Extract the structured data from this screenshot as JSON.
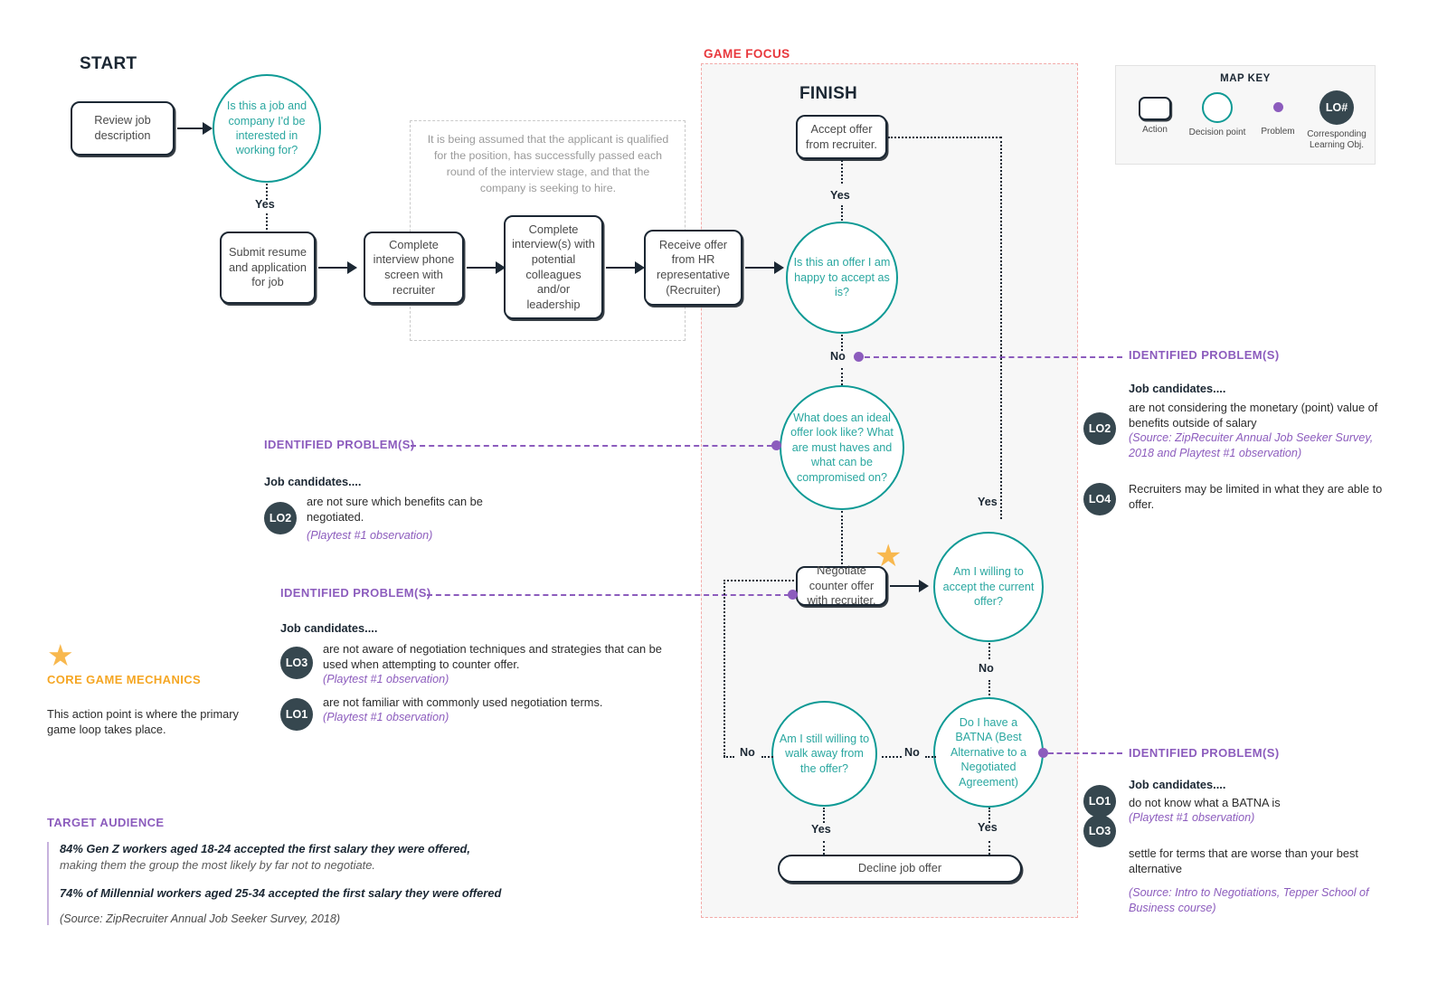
{
  "diagram": {
    "start_label": "START",
    "finish_label": "FINISH",
    "game_focus_label": "GAME FOCUS",
    "assumption_note": "It is being assumed that the applicant is qualified for the position, has successfully passed each round of the interview stage, and that the company is seeking to hire.",
    "colors": {
      "teal": "#0f9a95",
      "purple": "#8c5cbd",
      "red": "#e8383d",
      "orange": "#f5a623",
      "slate": "#36474f",
      "focus_bg": "#f7f7f7",
      "focus_border": "#f3aaa8"
    },
    "nodes": {
      "review_job": "Review job description",
      "interested": "Is this a job and company I'd be interested in working for?",
      "submit_resume": "Submit resume and application for job",
      "phone_screen": "Complete interview phone screen with recruiter",
      "interviews": "Complete interview(s) with potential colleagues and/or leadership",
      "receive_offer": "Receive offer from HR representative (Recruiter)",
      "accept_offer": "Accept offer from recruiter.",
      "happy_to_accept": "Is this an offer I am happy to accept as is?",
      "ideal_offer": "What does an ideal offer look like? What are must haves and what can be compromised on?",
      "negotiate": "Negotiate counter offer with recruiter.",
      "willing_accept_current": "Am I willing to accept the current offer?",
      "walk_away": "Am I still willing to walk away from the offer?",
      "batna": "Do I have a BATNA (Best Alternative to a Negotiated Agreement)",
      "decline": "Decline job offer"
    },
    "edges": {
      "yes_interested": "Yes",
      "yes_accept": "Yes",
      "no_happy": "No",
      "yes_willing": "Yes",
      "no_willing": "No",
      "no_batna": "No",
      "no_walkaway": "No",
      "yes_walkaway": "Yes",
      "yes_batna": "Yes"
    }
  },
  "map_key": {
    "title": "MAP KEY",
    "items": [
      {
        "shape": "action",
        "label": "Action"
      },
      {
        "shape": "decision",
        "label": "Decision point"
      },
      {
        "shape": "problem",
        "label": "Problem"
      },
      {
        "shape": "lo",
        "badge": "LO#",
        "label": "Corresponding Learning Obj."
      }
    ]
  },
  "problems": {
    "left_upper": {
      "heading": "IDENTIFIED PROBLEM(S)",
      "subheading": "Job candidates....",
      "items": [
        {
          "lo": "LO2",
          "text": "are not sure which benefits can be negotiated.",
          "source": "(Playtest #1 observation)"
        }
      ]
    },
    "left_lower": {
      "heading": "IDENTIFIED PROBLEM(S)",
      "subheading": "Job candidates....",
      "items": [
        {
          "lo": "LO3",
          "text": "are not aware of negotiation techniques and strategies that can be used when attempting to counter offer.",
          "source": "(Playtest #1 observation)"
        },
        {
          "lo": "LO1",
          "text": "are not familiar with commonly used negotiation terms.",
          "source": "(Playtest #1 observation)"
        }
      ]
    },
    "right_upper": {
      "heading": "IDENTIFIED PROBLEM(S)",
      "subheading": "Job candidates....",
      "items": [
        {
          "lo": "LO2",
          "text": "are not considering the monetary (point) value of benefits outside of salary",
          "source": "(Source: ZipRecuiter Annual Job Seeker Survey, 2018 and Playtest #1 observation)"
        },
        {
          "lo": "LO4",
          "text": "Recruiters may be limited in what they are able to offer.",
          "source": ""
        }
      ]
    },
    "right_lower": {
      "heading": "IDENTIFIED PROBLEM(S)",
      "subheading": "Job candidates....",
      "items": [
        {
          "lo": "LO1",
          "text": "do not know what a BATNA is",
          "source": "(Playtest #1 observation)"
        },
        {
          "lo": "LO3",
          "text": "settle for terms that are worse than your best alternative",
          "source": "(Source: Intro to Negotiations, Tepper School of Business course)"
        }
      ]
    }
  },
  "core_game_mechanics": {
    "title": "CORE GAME MECHANICS",
    "body": "This action point is where the primary game loop takes place."
  },
  "target_audience": {
    "title": "TARGET AUDIENCE",
    "stat1_bold": "84% Gen Z workers aged 18-24 accepted the first salary they were offered,",
    "stat1_light": "making them the group the most likely by far not to negotiate.",
    "stat2_bold": "74% of Millennial workers aged 25-34 accepted the first salary they were offered",
    "source": "(Source:  ZipRecruiter Annual Job Seeker Survey, 2018)"
  }
}
